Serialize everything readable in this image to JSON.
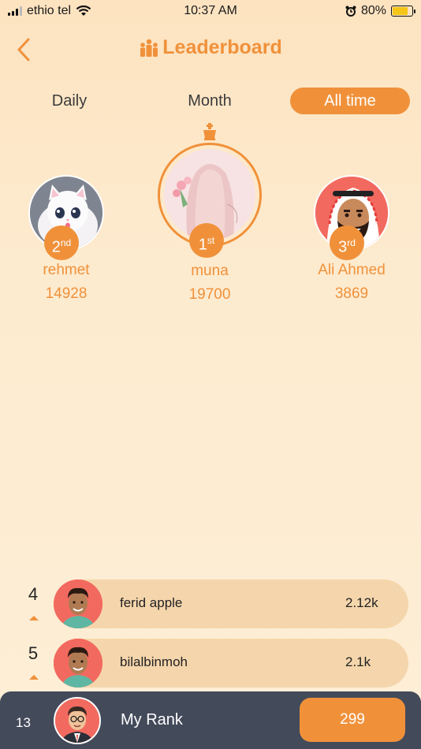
{
  "status_bar": {
    "carrier": "ethio tel",
    "time": "10:37 AM",
    "battery": "80%",
    "battery_level": 0.8
  },
  "header": {
    "title": "Leaderboard",
    "back_icon": "chevron-left-icon",
    "title_icon": "people-group-icon"
  },
  "tabs": [
    {
      "label": "Daily",
      "active": false
    },
    {
      "label": "Month",
      "active": false
    },
    {
      "label": "All time",
      "active": true
    }
  ],
  "podium": {
    "first": {
      "name": "muna",
      "score": "19700",
      "rank": "1",
      "suffix": "st"
    },
    "second": {
      "name": "rehmet",
      "score": "14928",
      "rank": "2",
      "suffix": "nd"
    },
    "third": {
      "name": "Ali Ahmed",
      "score": "3869",
      "rank": "3",
      "suffix": "rd"
    }
  },
  "list": [
    {
      "rank": "4",
      "name": "ferid apple",
      "score": "2.12k"
    },
    {
      "rank": "5",
      "name": "bilalbinmoh",
      "score": "2.1k"
    }
  ],
  "my_rank": {
    "rank": "13",
    "label": "My Rank",
    "score": "299"
  },
  "colors": {
    "accent": "#f0913a",
    "row_bg": "#f5d6ac",
    "bottom_bar": "#434a5a"
  }
}
